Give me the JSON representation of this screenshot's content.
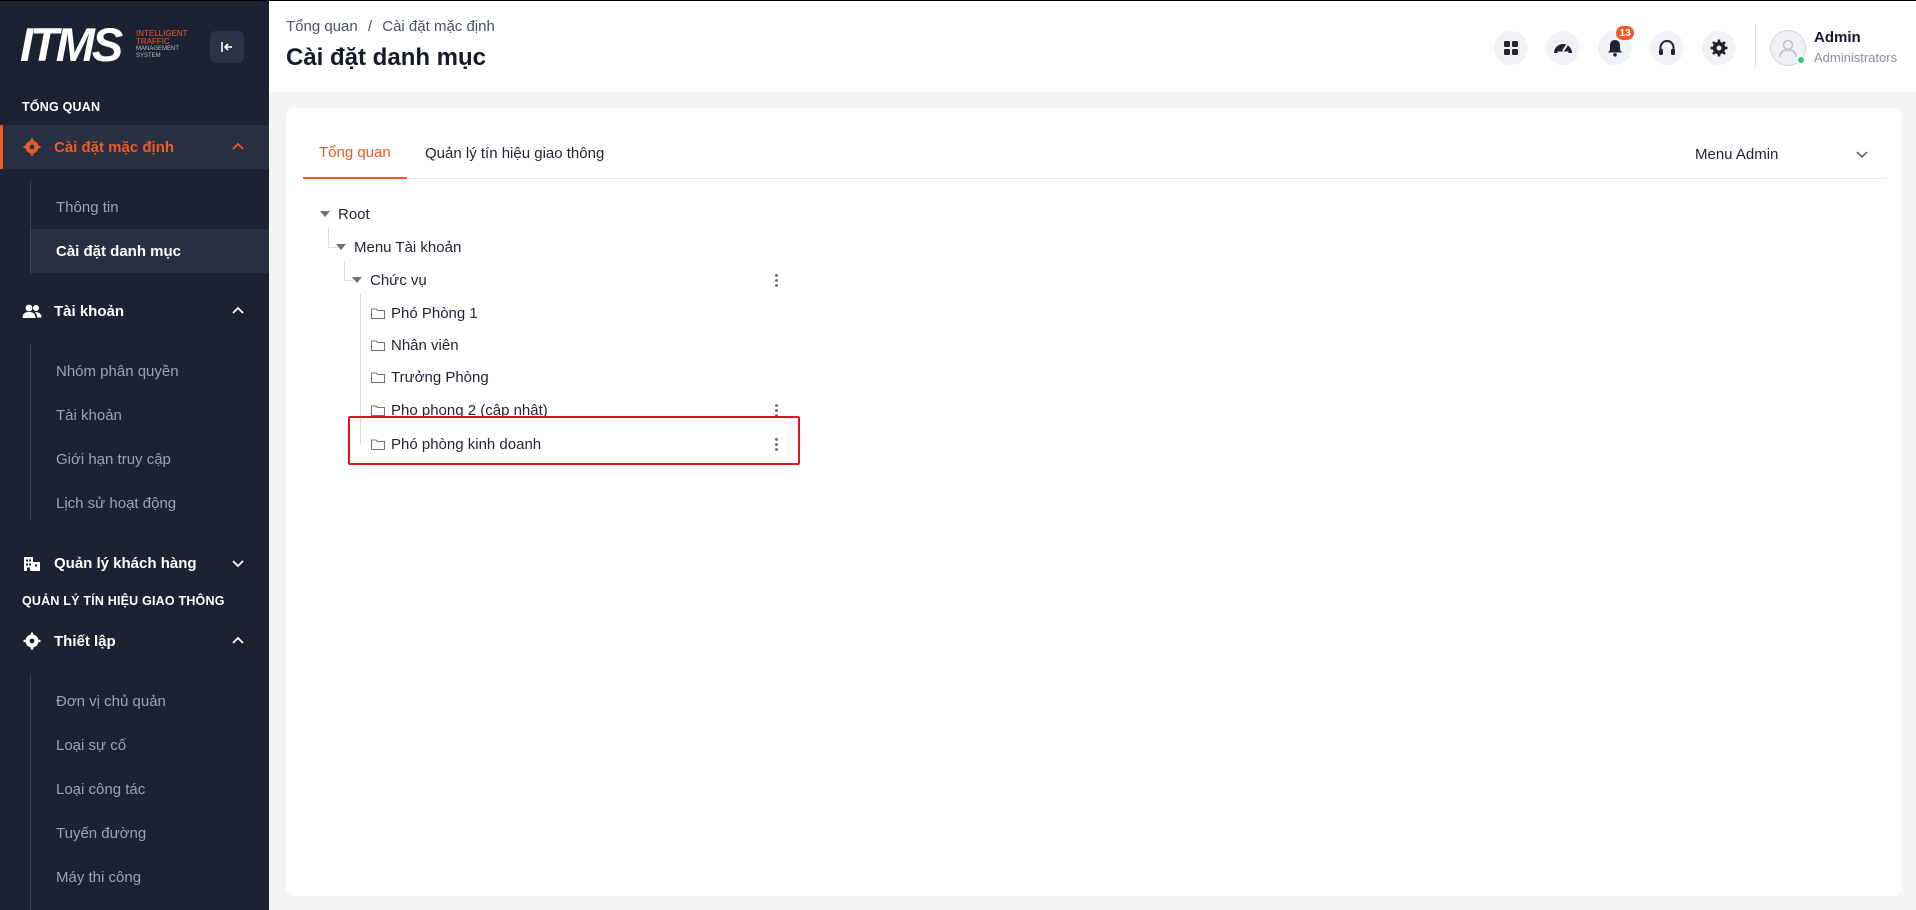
{
  "brand": {
    "logo_text": "ITMS",
    "tagline_1": "INTELLIGENT",
    "tagline_2": "TRAFFIC",
    "tagline_3": "MANAGEMENT",
    "tagline_4": "SYSTEM",
    "accent_color": "#ef5a24"
  },
  "sidebar": {
    "section_overview": "TỔNG QUAN",
    "group_default_settings": {
      "label": "Cài đặt mặc định",
      "icon": "gear-icon",
      "expanded": true
    },
    "default_settings_items": [
      "Thông tin",
      "Cài đặt danh mục"
    ],
    "group_accounts": {
      "label": "Tài khoản",
      "icon": "users-icon",
      "expanded": true
    },
    "account_items": [
      "Nhóm phân quyền",
      "Tài khoản",
      "Giới hạn truy cập",
      "Lịch sử hoạt động"
    ],
    "group_customers": {
      "label": "Quản lý khách hàng",
      "icon": "building-icon",
      "expanded": false
    },
    "section_traffic": "QUẢN LÝ TÍN HIỆU GIAO THÔNG",
    "group_setup": {
      "label": "Thiết lập",
      "icon": "gear-icon",
      "expanded": true
    },
    "setup_items": [
      "Đơn vị chủ quản",
      "Loại sự cố",
      "Loại công tác",
      "Tuyến đường",
      "Máy thi công"
    ]
  },
  "header": {
    "breadcrumb": [
      "Tổng quan",
      "/",
      "Cài đặt mặc định"
    ],
    "title": "Cài đặt danh mục",
    "notification_count": "13",
    "icons": [
      "apps-grid-icon",
      "dashboard-gauge-icon",
      "bell-icon",
      "headset-icon",
      "gear-icon"
    ],
    "user": {
      "name": "Admin",
      "role": "Administrators"
    }
  },
  "main": {
    "tabs": [
      "Tổng quan",
      "Quản lý tín hiệu giao thông"
    ],
    "active_tab": "Tổng quan",
    "menu_select": "Menu Admin",
    "tree": {
      "root": "Root",
      "level1": "Menu Tài khoản",
      "level2": "Chức vụ",
      "leaves": [
        "Phó Phòng 1",
        "Nhân viên",
        "Trưởng Phòng",
        "Pho phong 2 (cập nhật)",
        "Phó phòng kinh doanh"
      ]
    },
    "highlighted_item": "Phó phòng kinh doanh"
  }
}
